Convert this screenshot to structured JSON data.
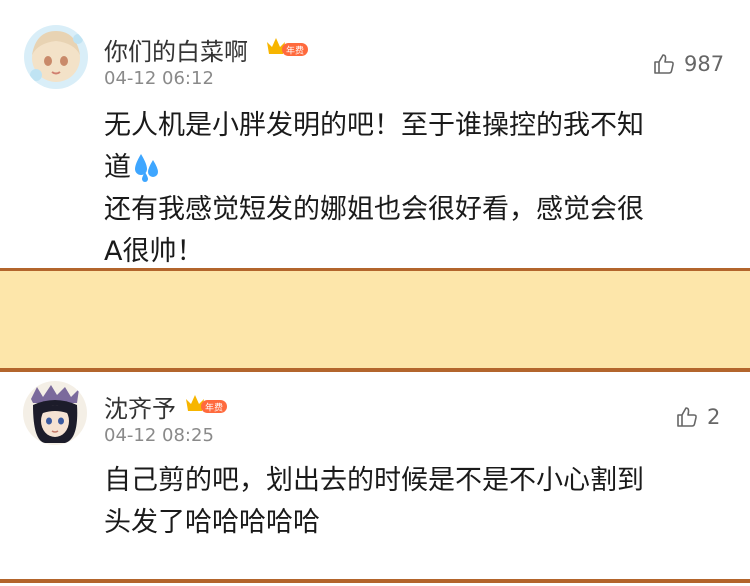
{
  "comments": [
    {
      "username": "你们的白菜啊",
      "badge_text": "年费",
      "time": "04-12 06:12",
      "likes": "987",
      "text_line1": "无人机是小胖发明的吧！至于谁操控的我不知",
      "text_line2": "道",
      "text_line3": "还有我感觉短发的娜姐也会很好看，感觉会很",
      "text_line4": "A很帅！",
      "emoji": "sweat-droplets-icon"
    },
    {
      "username": "沈齐予",
      "badge_text": "年费",
      "time": "04-12 08:25",
      "likes": "2",
      "text_line1": "自己剪的吧，划出去的时候是不是不小心割到",
      "text_line2": "头发了哈哈哈哈哈"
    }
  ],
  "colors": {
    "divider": "#b3652c",
    "highlight_band": "#fde6aa",
    "badge_red": "#ff6a3d",
    "crown_gold": "#f7b500"
  }
}
